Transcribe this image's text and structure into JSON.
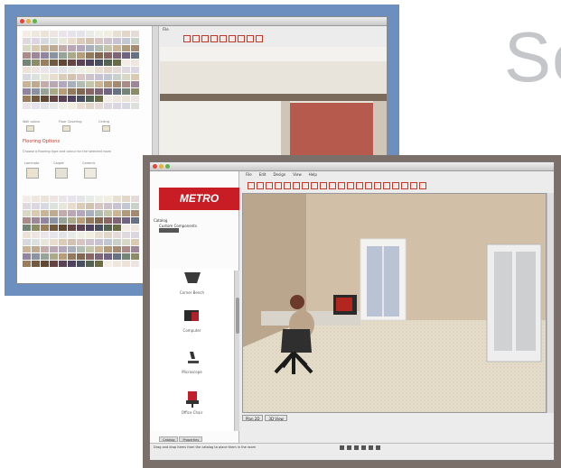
{
  "heading": {
    "text": "Se"
  },
  "back_window": {
    "colors": [
      "#f3ede5",
      "#efe7dd",
      "#ece2d6",
      "#eee5e3",
      "#ebe5ea",
      "#e7e3ec",
      "#e2e4ea",
      "#e6ebe6",
      "#efefe6",
      "#f2eedf",
      "#e9dfd0",
      "#e3d6c7",
      "#e5dad8",
      "#e0d8df",
      "#dcd6e3",
      "#d6d9e2",
      "#dbe2dc",
      "#e6e7d9",
      "#e8ddcb",
      "#dcccb5",
      "#d3c2b0",
      "#d7c4c3",
      "#d0c2cc",
      "#c9c2d4",
      "#c2c8d3",
      "#c8d2c9",
      "#d8d9c4",
      "#dccab0",
      "#c9b596",
      "#bfa98f",
      "#c4aaa9",
      "#bba6b3",
      "#b2a7bd",
      "#a8b0bd",
      "#b0bdb0",
      "#c4c5a6",
      "#cdb593",
      "#b19a78",
      "#a58a6f",
      "#ab8a88",
      "#9f8799",
      "#9185a3",
      "#8a93a4",
      "#95a496",
      "#aaab86",
      "#b89d76",
      "#94795a",
      "#846750",
      "#8a6564",
      "#7f6377",
      "#706384",
      "#677184",
      "#738574",
      "#8c8c65",
      "#9c7f5a",
      "#73593e",
      "#624733",
      "#674441",
      "#5d4154",
      "#4f4260",
      "#474f60",
      "#52634f",
      "#6b6b44"
    ],
    "label_1": "Wall colour",
    "label_2": "Floor Covering",
    "label_3": "Ceiling",
    "floor_title": "Flooring Options",
    "floor_note": "Choose a flooring type and colour for the selected room",
    "thumb_labels": [
      "Laminate",
      "Carpet",
      "Ceramic"
    ]
  },
  "front_window": {
    "logo_text": "METRO",
    "tree_label_1": "Catalog",
    "tree_label_2": "Custom Components",
    "catalog_items": [
      {
        "label": "Corner Bench"
      },
      {
        "label": "Computer"
      },
      {
        "label": "Microscope"
      },
      {
        "label": "Office Chair"
      }
    ],
    "menu_items": [
      "File",
      "Edit",
      "Design",
      "View",
      "Help"
    ],
    "view_tabs": [
      "Plan 2D",
      "3D View"
    ],
    "lower_tabs": [
      "Catalog",
      "Properties"
    ],
    "status_text": "Drag and drop items from the catalog to place them in the room"
  }
}
